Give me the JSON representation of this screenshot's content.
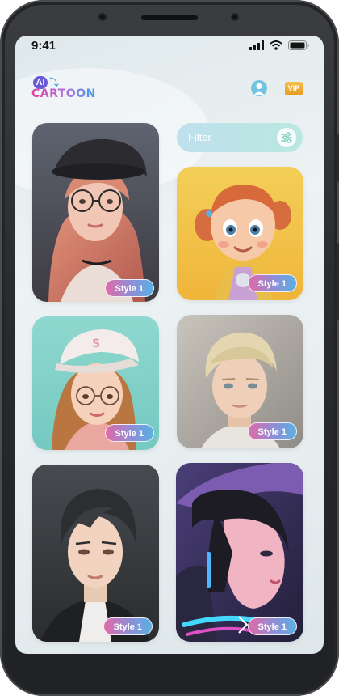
{
  "status_bar": {
    "time": "9:41"
  },
  "header": {
    "logo_ai": "AI",
    "logo_text": "CARTOON",
    "vip_label": "VIP",
    "profile_icon": "user-icon"
  },
  "filter": {
    "placeholder": "Filter",
    "icon": "sliders-icon"
  },
  "gallery": {
    "cards": [
      {
        "subject": "girl with beret and glasses",
        "style_label": "Style 1"
      },
      {
        "subject": "3d cartoon girl with red pigtails",
        "style_label": "Style 1"
      },
      {
        "subject": "girl with white cap and glasses",
        "style_label": "Style 1"
      },
      {
        "subject": "blond young man",
        "style_label": "Style 1"
      },
      {
        "subject": "dark-haired young man",
        "style_label": "Style 1"
      },
      {
        "subject": "neon-lit girl with hat",
        "style_label": "Style 1"
      }
    ]
  },
  "colors": {
    "accent_gradient_start": "#e06aa8",
    "accent_gradient_end": "#5ab0e3",
    "filter_gradient_start": "#bfe0ee",
    "filter_gradient_end": "#b9e8df",
    "vip": "#f0b33a"
  }
}
